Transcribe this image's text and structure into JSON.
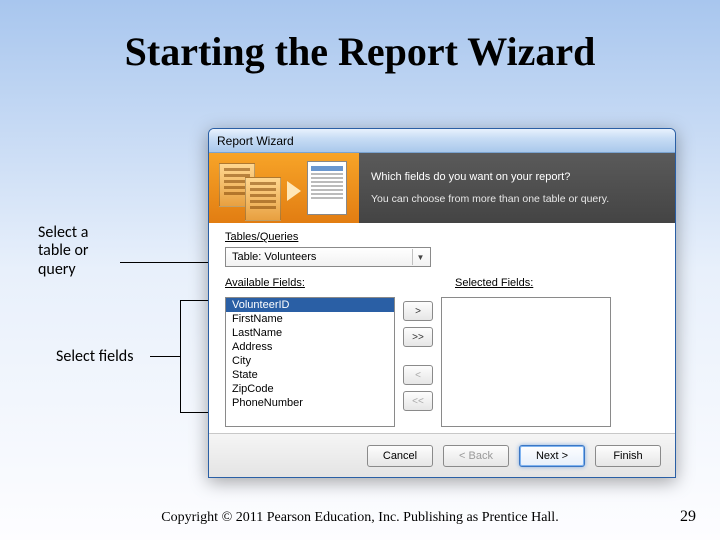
{
  "slide": {
    "title": "Starting the Report Wizard",
    "callout1": "Select a table or query",
    "callout2": "Select fields",
    "copyright": "Copyright © 2011 Pearson Education, Inc. Publishing as Prentice Hall.",
    "page_number": "29"
  },
  "window": {
    "title": "Report Wizard",
    "prompt1": "Which fields do you want on your report?",
    "prompt2": "You can choose from more than one table or query.",
    "tables_label": "Tables/Queries",
    "combo_value": "Table: Volunteers",
    "available_label": "Available Fields:",
    "selected_label": "Selected Fields:",
    "available_fields": [
      "VolunteerID",
      "FirstName",
      "LastName",
      "Address",
      "City",
      "State",
      "ZipCode",
      "PhoneNumber"
    ],
    "selected_index": 0,
    "btn_add": ">",
    "btn_add_all": ">>",
    "btn_remove": "<",
    "btn_remove_all": "<<",
    "footer": {
      "cancel": "Cancel",
      "back": "< Back",
      "next": "Next >",
      "finish": "Finish"
    }
  }
}
